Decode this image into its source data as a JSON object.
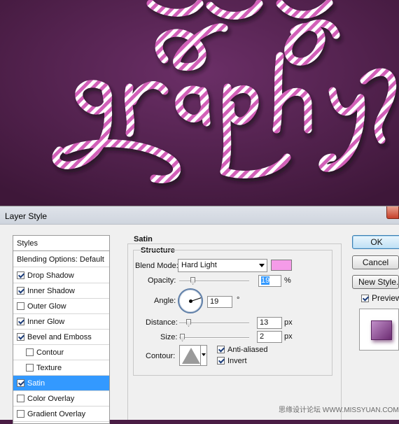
{
  "artwork": {
    "background": "#4a1d45",
    "stripe_colors": [
      "#d25fb8",
      "#ffffff"
    ]
  },
  "dialog": {
    "title": "Layer Style",
    "close_icon": "close-icon"
  },
  "styles_list": {
    "items": [
      {
        "label": "Styles",
        "checkbox": false,
        "checked": false
      },
      {
        "label": "Blending Options: Default",
        "checkbox": false,
        "checked": false
      },
      {
        "label": "Drop Shadow",
        "checkbox": true,
        "checked": true
      },
      {
        "label": "Inner Shadow",
        "checkbox": true,
        "checked": true
      },
      {
        "label": "Outer Glow",
        "checkbox": true,
        "checked": false
      },
      {
        "label": "Inner Glow",
        "checkbox": true,
        "checked": true
      },
      {
        "label": "Bevel and Emboss",
        "checkbox": true,
        "checked": true
      },
      {
        "label": "Contour",
        "checkbox": true,
        "checked": false
      },
      {
        "label": "Texture",
        "checkbox": true,
        "checked": false
      },
      {
        "label": "Satin",
        "checkbox": true,
        "checked": true,
        "selected": true
      },
      {
        "label": "Color Overlay",
        "checkbox": true,
        "checked": false
      },
      {
        "label": "Gradient Overlay",
        "checkbox": true,
        "checked": false
      }
    ]
  },
  "satin": {
    "section_title": "Satin",
    "group_title": "Structure",
    "blend_mode_label": "Blend Mode:",
    "blend_mode_value": "Hard Light",
    "swatch_color": "#f59be8",
    "opacity_label": "Opacity:",
    "opacity_value": "19",
    "opacity_unit": "%",
    "angle_label": "Angle:",
    "angle_value": "19",
    "angle_unit": "°",
    "distance_label": "Distance:",
    "distance_value": "13",
    "distance_unit": "px",
    "size_label": "Size:",
    "size_value": "2",
    "size_unit": "px",
    "contour_label": "Contour:",
    "anti_aliased_label": "Anti-aliased",
    "anti_aliased_checked": true,
    "invert_label": "Invert",
    "invert_checked": true
  },
  "buttons": {
    "ok": "OK",
    "cancel": "Cancel",
    "new_style": "New Style...",
    "preview_label": "Preview",
    "preview_checked": true
  },
  "watermark": "思缘设计论坛 WWW.MISSYUAN.COM"
}
